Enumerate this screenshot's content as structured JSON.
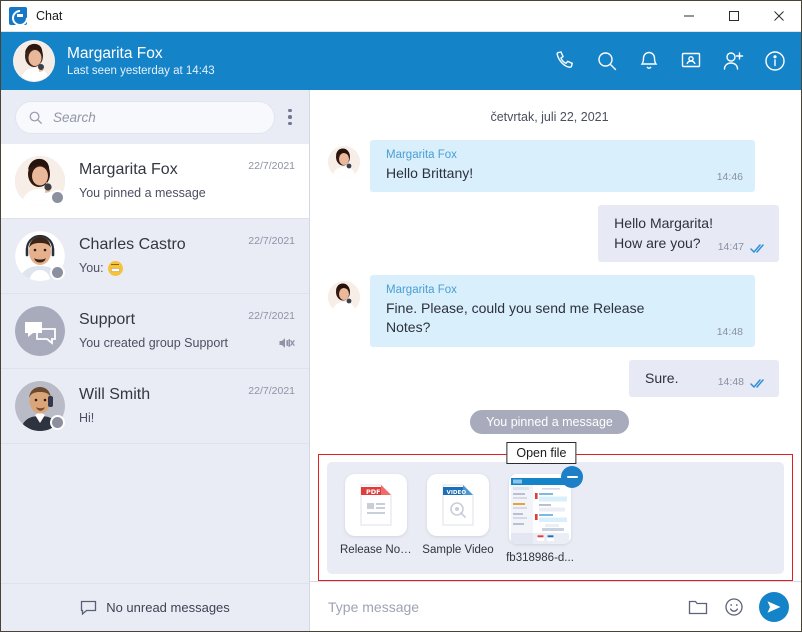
{
  "window": {
    "app_title": "Chat",
    "logo_icon": "chat-app-logo",
    "minimize_label": "—",
    "maximize_label": "□",
    "close_label": "✕"
  },
  "header": {
    "contact_name": "Margarita Fox",
    "status": "Last seen yesterday at 14:43",
    "background_color": "#1583c8",
    "icons": [
      {
        "name": "call-icon",
        "label": "Call"
      },
      {
        "name": "search-icon",
        "label": "Search"
      },
      {
        "name": "notifications-bell-icon",
        "label": "Notifications"
      },
      {
        "name": "screen-share-icon",
        "label": "Screen share"
      },
      {
        "name": "add-contact-icon",
        "label": "Add contact"
      },
      {
        "name": "info-icon",
        "label": "Info"
      }
    ]
  },
  "sidebar": {
    "search": {
      "placeholder": "Search",
      "value": "",
      "icon": "search-icon"
    },
    "menu_icon": "kebab-menu-icon",
    "contacts": [
      {
        "name": "Margarita Fox",
        "preview": "You pinned a message",
        "date": "22/7/2021",
        "active": true,
        "muted": false,
        "avatar_type": "photo-woman-phone",
        "status": "offline"
      },
      {
        "name": "Charles Castro",
        "preview": "You: ",
        "has_emoji": true,
        "date": "22/7/2021",
        "active": false,
        "muted": false,
        "avatar_type": "photo-man-headset",
        "status": "offline"
      },
      {
        "name": "Support",
        "preview": "You created group Support",
        "date": "22/7/2021",
        "active": false,
        "muted": true,
        "avatar_type": "group-chat-bubbles",
        "status": "none"
      },
      {
        "name": "Will Smith",
        "preview": "Hi!",
        "date": "22/7/2021",
        "active": false,
        "muted": false,
        "avatar_type": "photo-man-suit-phone",
        "status": "offline"
      }
    ],
    "footer": {
      "text": "No unread messages",
      "icon": "chat-bubble-icon"
    }
  },
  "chat": {
    "date_separator": "četvrtak, juli 22, 2021",
    "messages": [
      {
        "direction": "in",
        "sender": "Margarita Fox",
        "text": "Hello Brittany!",
        "time": "14:46",
        "read": false
      },
      {
        "direction": "out",
        "sender": "",
        "text": "Hello Margarita!\nHow are you?",
        "time": "14:47",
        "read": true
      },
      {
        "direction": "in",
        "sender": "Margarita Fox",
        "text": "Fine. Please, could you send me Release Notes?",
        "time": "14:48",
        "read": false
      },
      {
        "direction": "out",
        "sender": "",
        "text": "Sure.",
        "time": "14:48",
        "read": true
      }
    ],
    "system_note": "You pinned a message",
    "bubble_in_color": "#d9effc",
    "bubble_out_color": "#e7eaf5"
  },
  "attachments": {
    "highlight_color": "#e02020",
    "tooltip": "Open file",
    "files": [
      {
        "name": "Release Notes",
        "type": "pdf",
        "icon": "pdf-file-icon",
        "badge_label": "PDF"
      },
      {
        "name": "Sample Video",
        "type": "video",
        "icon": "video-file-icon",
        "badge_label": "VIDEO"
      },
      {
        "name": "fb318986-d...",
        "type": "image",
        "icon": "image-thumbnail",
        "has_minus_badge": true
      }
    ]
  },
  "composer": {
    "placeholder": "Type message",
    "value": "",
    "attach_icon": "folder-icon",
    "emoji_icon": "smiley-icon",
    "send_icon": "send-plane-icon"
  }
}
